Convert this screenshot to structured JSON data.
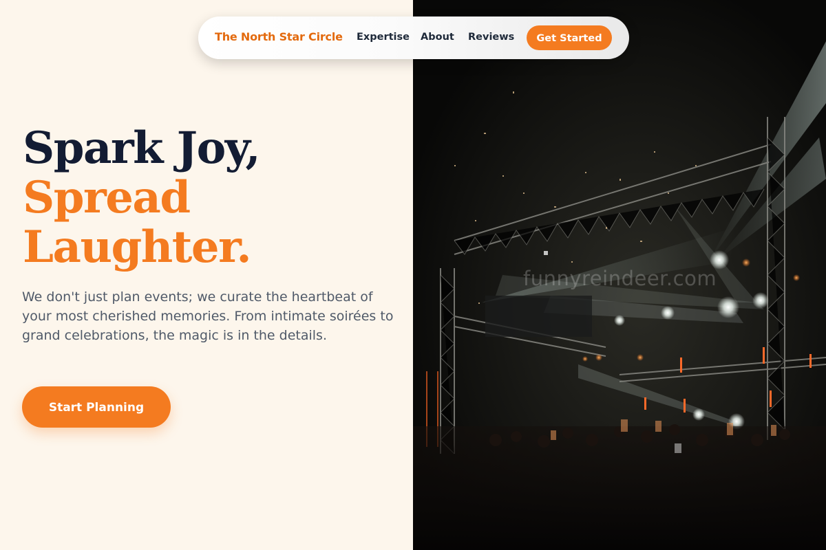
{
  "nav": {
    "brand": "The North Star Circle",
    "links": [
      "Expertise",
      "About",
      "Reviews"
    ],
    "cta": "Get Started"
  },
  "hero": {
    "headline_line1": "Spark Joy,",
    "headline_line2": "Spread",
    "headline_line3": "Laughter.",
    "description": "We don't just plan events; we curate the heartbeat of your most cherished memories. From intimate soirées to grand celebrations, the magic is in the details.",
    "cta": "Start Planning"
  },
  "image": {
    "description": "concert-stage-with-spotlights-photo",
    "watermark": "funnyreindeer.com"
  },
  "colors": {
    "accent": "#f47b20",
    "heading_dark": "#131c33",
    "body_text": "#4f5968",
    "background": "#fdf6ec"
  }
}
